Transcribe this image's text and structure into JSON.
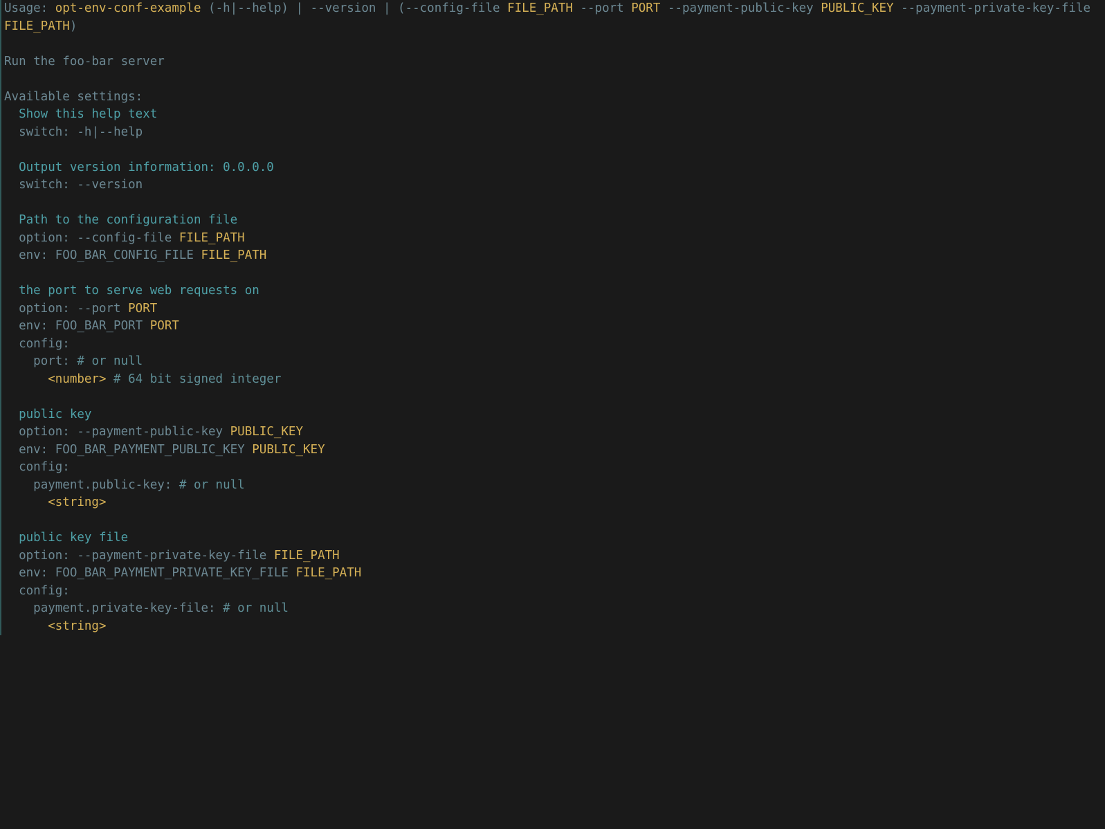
{
  "usage": {
    "label": "Usage: ",
    "prog": "opt-env-conf-example",
    "s1": " (",
    "h1": "-h",
    "pipe1": "|",
    "h2": "--help",
    "s2": ") ",
    "pipe2": "|",
    "s3": " ",
    "ver": "--version",
    "s4": " ",
    "pipe3": "|",
    "s5": " (",
    "cfgflag": "--config-file",
    "sp1": " ",
    "cfgarg": "FILE_PATH",
    "sp2": " ",
    "portflag": "--port",
    "sp3": " ",
    "portarg": "PORT",
    "sp4": " ",
    "ppkflag": "--payment-public-key",
    "sp5": " ",
    "ppkarg": "PUBLIC_KEY",
    "sp6": " ",
    "ppkfflag": "--payment-private-key-file",
    "sp7": " ",
    "ppkfarg": "FILE_PATH",
    "s6": ")"
  },
  "desc": "Run the foo-bar server",
  "available": "Available settings:",
  "indent1": "  ",
  "indent2": "    ",
  "indent3": "      ",
  "s_help": {
    "title": "Show this help text",
    "switch_lbl": "switch: ",
    "switch_a": "-h",
    "switch_pipe": "|",
    "switch_b": "--help"
  },
  "s_version": {
    "title": "Output version information: 0.0.0.0",
    "switch_lbl": "switch: ",
    "switch_a": "--version"
  },
  "s_cfg": {
    "title": "Path to the configuration file",
    "opt_lbl": "option: ",
    "opt_flag": "--config-file",
    "sp": " ",
    "opt_arg": "FILE_PATH",
    "env_lbl": "env: ",
    "env_var": "FOO_BAR_CONFIG_FILE",
    "env_arg": "FILE_PATH"
  },
  "s_port": {
    "title": "the port to serve web requests on",
    "opt_lbl": "option: ",
    "opt_flag": "--port",
    "sp": " ",
    "opt_arg": "PORT",
    "env_lbl": "env: ",
    "env_var": "FOO_BAR_PORT",
    "env_arg": "PORT",
    "config_lbl": "config:",
    "ckey": "port:",
    "ccomment": " # or null",
    "ctype": "<number>",
    "ctypecomment": " # 64 bit signed integer"
  },
  "s_ppk": {
    "title": "public key",
    "opt_lbl": "option: ",
    "opt_flag": "--payment-public-key",
    "sp": " ",
    "opt_arg": "PUBLIC_KEY",
    "env_lbl": "env: ",
    "env_var": "FOO_BAR_PAYMENT_PUBLIC_KEY",
    "env_arg": "PUBLIC_KEY",
    "config_lbl": "config:",
    "ckey": "payment.public-key:",
    "ccomment": " # or null",
    "ctype": "<string>"
  },
  "s_ppkf": {
    "title": "public key file",
    "opt_lbl": "option: ",
    "opt_flag": "--payment-private-key-file",
    "sp": " ",
    "opt_arg": "FILE_PATH",
    "env_lbl": "env: ",
    "env_var": "FOO_BAR_PAYMENT_PRIVATE_KEY_FILE",
    "env_arg": "FILE_PATH",
    "config_lbl": "config:",
    "ckey": "payment.private-key-file:",
    "ccomment": " # or null",
    "ctype": "<string>"
  }
}
